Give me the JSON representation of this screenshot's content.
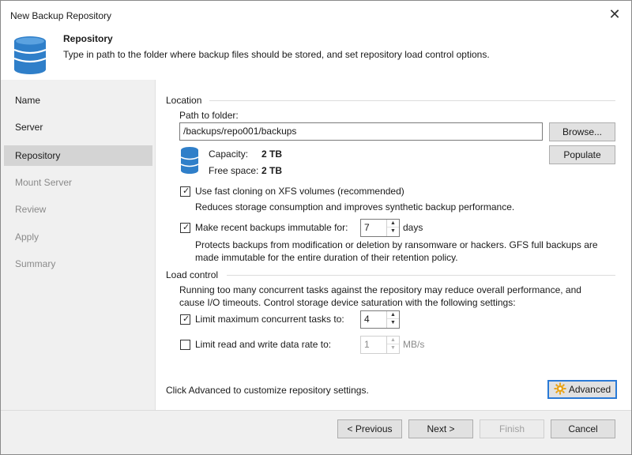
{
  "window": {
    "title": "New Backup Repository"
  },
  "header": {
    "title": "Repository",
    "description": "Type in path to the folder where backup files should be stored, and set repository load control options."
  },
  "nav": {
    "items": [
      {
        "label": "Name"
      },
      {
        "label": "Server"
      },
      {
        "label": "Repository"
      },
      {
        "label": "Mount Server"
      },
      {
        "label": "Review"
      },
      {
        "label": "Apply"
      },
      {
        "label": "Summary"
      }
    ]
  },
  "location": {
    "section_title": "Location",
    "path_label": "Path to folder:",
    "path_value": "/backups/repo001/backups",
    "browse_label": "Browse...",
    "populate_label": "Populate",
    "capacity_label": "Capacity:",
    "capacity_value": "2 TB",
    "free_space_label": "Free space:",
    "free_space_value": "2 TB",
    "fast_cloning": {
      "checked": true,
      "label": "Use fast cloning on XFS volumes (recommended)",
      "description": "Reduces storage consumption and improves synthetic backup performance."
    },
    "immutable": {
      "checked": true,
      "label": "Make recent backups immutable for:",
      "value": "7",
      "unit": "days",
      "description_line1": "Protects backups from modification or deletion by ransomware or hackers. GFS full backups are",
      "description_line2": "made immutable for the entire duration of their retention policy."
    }
  },
  "load_control": {
    "section_title": "Load control",
    "description_line1": "Running too many concurrent tasks against the repository may reduce overall performance, and",
    "description_line2": "cause I/O timeouts. Control storage device saturation with the following settings:",
    "limit_tasks": {
      "checked": true,
      "label": "Limit maximum concurrent tasks to:",
      "value": "4"
    },
    "limit_rate": {
      "checked": false,
      "label": "Limit read and write data rate to:",
      "value": "1",
      "unit": "MB/s"
    }
  },
  "advanced": {
    "hint": "Click Advanced to customize repository settings.",
    "button_label": "Advanced"
  },
  "footer": {
    "previous_label": "< Previous",
    "next_label": "Next >",
    "finish_label": "Finish",
    "cancel_label": "Cancel"
  },
  "colors": {
    "db_icon_blue": "#2f7fc9",
    "focus_blue": "#2a7ad6",
    "gear_orange": "#e8a317"
  }
}
